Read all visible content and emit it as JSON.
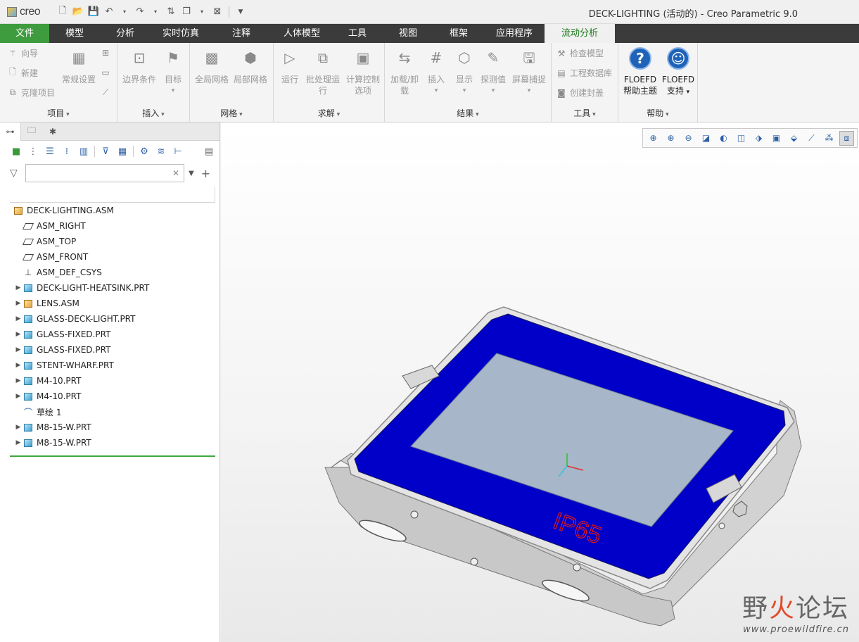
{
  "app": {
    "logo_text": "creo",
    "window_title": "DECK-LIGHTING (活动的) - Creo Parametric 9.0"
  },
  "tabs": [
    {
      "label": "文件"
    },
    {
      "label": "模型"
    },
    {
      "label": "分析"
    },
    {
      "label": "实时仿真"
    },
    {
      "label": "注释"
    },
    {
      "label": "人体模型"
    },
    {
      "label": "工具"
    },
    {
      "label": "视图"
    },
    {
      "label": "框架"
    },
    {
      "label": "应用程序"
    },
    {
      "label": "流动分析"
    }
  ],
  "ribbon": {
    "project": {
      "label": "项目",
      "wizard": "向导",
      "new": "新建",
      "clone": "克隆项目",
      "general_settings": "常规设置"
    },
    "insert": {
      "label": "插入",
      "boundary": "边界条件",
      "goal": "目标"
    },
    "mesh": {
      "label": "网格",
      "global": "全局网格",
      "local": "局部网格"
    },
    "solve": {
      "label": "求解",
      "run": "运行",
      "batch_line1": "批处理运",
      "batch_line2": "行",
      "calc_line1": "计算控制",
      "calc_line2": "选项"
    },
    "results": {
      "label": "结果",
      "load_line1": "加载/卸",
      "load_line2": "载",
      "insert": "插入",
      "display": "显示",
      "probe": "探测值",
      "capture": "屏幕捕捉"
    },
    "tools": {
      "label": "工具",
      "check": "检查模型",
      "database": "工程数据库",
      "enclosure": "创建封盖"
    },
    "help": {
      "label": "帮助",
      "help_line1": "FLOEFD",
      "help_line2": "帮助主题",
      "support_line1": "FLOEFD",
      "support_line2": "支持"
    }
  },
  "model_tree": {
    "search_value": "",
    "items": [
      {
        "label": "DECK-LIGHTING.ASM",
        "type": "asm",
        "expandable": false,
        "indent": 0
      },
      {
        "label": "ASM_RIGHT",
        "type": "plane",
        "expandable": false,
        "indent": 1
      },
      {
        "label": "ASM_TOP",
        "type": "plane",
        "expandable": false,
        "indent": 1
      },
      {
        "label": "ASM_FRONT",
        "type": "plane",
        "expandable": false,
        "indent": 1
      },
      {
        "label": "ASM_DEF_CSYS",
        "type": "csys",
        "expandable": false,
        "indent": 1
      },
      {
        "label": "DECK-LIGHT-HEATSINK.PRT",
        "type": "part",
        "expandable": true,
        "indent": 1
      },
      {
        "label": "LENS.ASM",
        "type": "asm",
        "expandable": true,
        "indent": 1
      },
      {
        "label": "GLASS-DECK-LIGHT.PRT",
        "type": "part",
        "expandable": true,
        "indent": 1
      },
      {
        "label": "GLASS-FIXED.PRT",
        "type": "part",
        "expandable": true,
        "indent": 1
      },
      {
        "label": "GLASS-FIXED.PRT",
        "type": "part",
        "expandable": true,
        "indent": 1
      },
      {
        "label": "STENT-WHARF.PRT",
        "type": "part",
        "expandable": true,
        "indent": 1
      },
      {
        "label": "M4-10.PRT",
        "type": "part",
        "expandable": true,
        "indent": 1
      },
      {
        "label": "M4-10.PRT",
        "type": "part",
        "expandable": true,
        "indent": 1
      },
      {
        "label": "草绘 1",
        "type": "sketch",
        "expandable": false,
        "indent": 1
      },
      {
        "label": "M8-15-W.PRT",
        "type": "part",
        "expandable": true,
        "indent": 1
      },
      {
        "label": "M8-15-W.PRT",
        "type": "part",
        "expandable": true,
        "indent": 1
      }
    ]
  },
  "model": {
    "label_text": "IP65",
    "colors": {
      "frame": "#0000c8",
      "glass": "#a7b6c8",
      "body": "#d6d6d6",
      "label": "#e0161b"
    }
  },
  "watermark": {
    "text_a": "野",
    "text_fire": "火",
    "text_b": "论坛",
    "url": "www.proewildfire.cn"
  }
}
